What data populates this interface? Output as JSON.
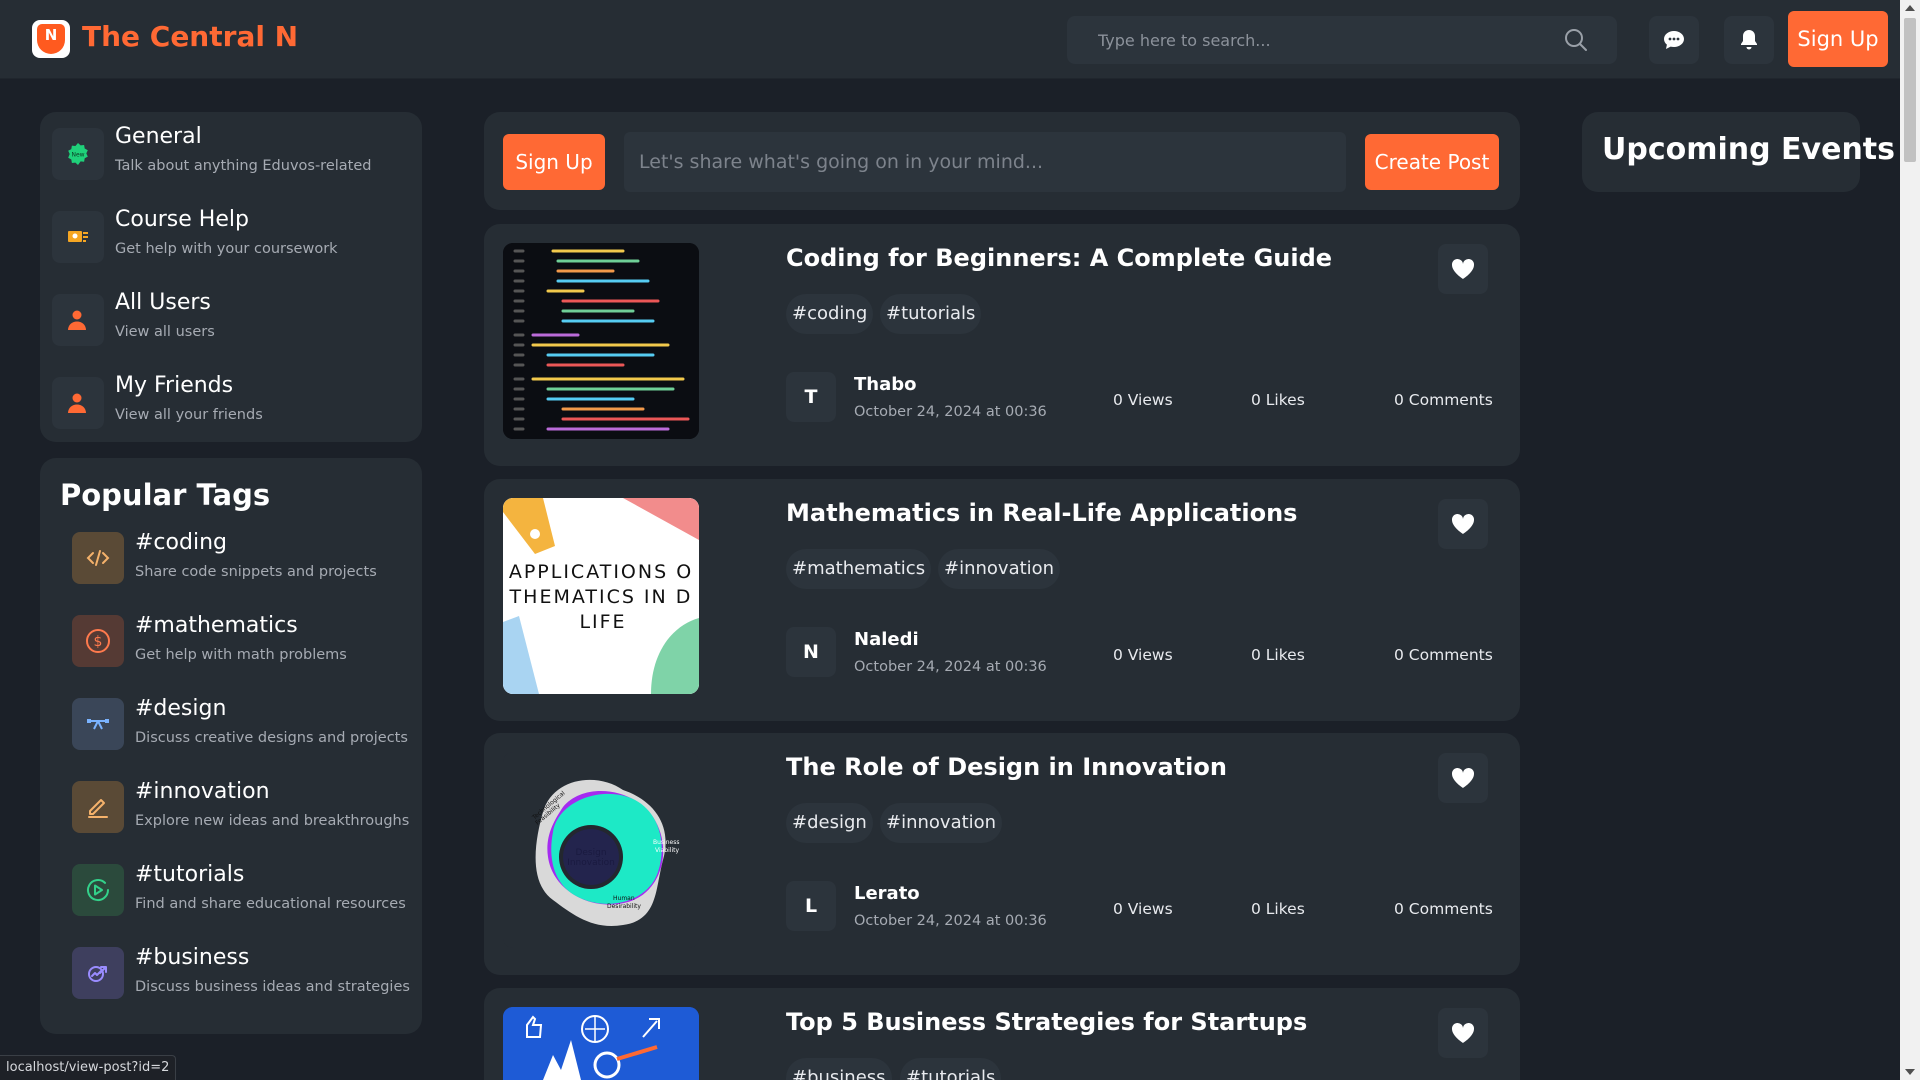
{
  "brand": {
    "name": "The Central N",
    "logo_letter": "N"
  },
  "header": {
    "search_placeholder": "Type here to search...",
    "signup_label": "Sign Up"
  },
  "sidebar": {
    "nav": [
      {
        "title": "General",
        "subtitle": "Talk about anything Eduvos-related",
        "icon": "badge-icon"
      },
      {
        "title": "Course Help",
        "subtitle": "Get help with your coursework",
        "icon": "course-icon"
      },
      {
        "title": "All Users",
        "subtitle": "View all users",
        "icon": "user-icon"
      },
      {
        "title": "My Friends",
        "subtitle": "View all your friends",
        "icon": "user-icon"
      }
    ],
    "tags_title": "Popular Tags",
    "tags": [
      {
        "title": "#coding",
        "subtitle": "Share code snippets and projects",
        "icon": "code-icon"
      },
      {
        "title": "#mathematics",
        "subtitle": "Get help with math problems",
        "icon": "dollar-icon"
      },
      {
        "title": "#design",
        "subtitle": "Discuss creative designs and projects",
        "icon": "design-icon"
      },
      {
        "title": "#innovation",
        "subtitle": "Explore new ideas and breakthroughs",
        "icon": "pen-icon"
      },
      {
        "title": "#tutorials",
        "subtitle": "Find and share educational resources",
        "icon": "play-icon"
      },
      {
        "title": "#business",
        "subtitle": "Discuss business ideas and strategies",
        "icon": "chart-icon"
      }
    ]
  },
  "composer": {
    "signup_label": "Sign Up",
    "placeholder": "Let's share what's going on in your mind...",
    "create_label": "Create Post"
  },
  "posts": [
    {
      "title": "Coding for Beginners: A Complete Guide",
      "tags": [
        "#coding",
        "#tutorials"
      ],
      "author_initial": "T",
      "author": "Thabo",
      "date": "October 24, 2024 at 00:36",
      "views": "0 Views",
      "likes": "0 Likes",
      "comments": "0 Comments"
    },
    {
      "title": "Mathematics in Real-Life Applications",
      "tags": [
        "#mathematics",
        "#innovation"
      ],
      "author_initial": "N",
      "author": "Naledi",
      "date": "October 24, 2024 at 00:36",
      "views": "0 Views",
      "likes": "0 Likes",
      "comments": "0 Comments",
      "image_lines": [
        "APPLICATIONS O",
        "THEMATICS IN D",
        "LIFE"
      ]
    },
    {
      "title": "The Role of Design in Innovation",
      "tags": [
        "#design",
        "#innovation"
      ],
      "author_initial": "L",
      "author": "Lerato",
      "date": "October 24, 2024 at 00:36",
      "views": "0 Views",
      "likes": "0 Likes",
      "comments": "0 Comments",
      "image_labels": [
        "Design",
        "Innovation",
        "Technological",
        "Feasibility",
        "Business",
        "Viability",
        "Human",
        "Desirability"
      ]
    },
    {
      "title": "Top 5 Business Strategies for Startups",
      "tags": [
        "#business",
        "#tutorials"
      ]
    }
  ],
  "events": {
    "title": "Upcoming Events"
  },
  "statusbar": {
    "url": "localhost/view-post?id=2"
  },
  "colors": {
    "accent": "#ff6934",
    "background": "#1b2028",
    "card": "#262d34",
    "chip": "#2c343c"
  }
}
